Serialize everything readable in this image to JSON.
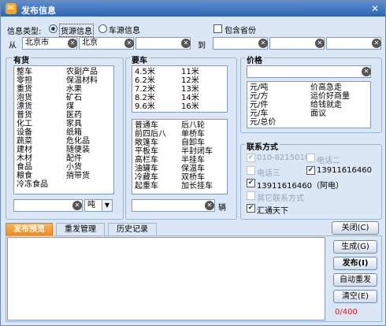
{
  "window": {
    "title": "发布信息"
  },
  "info_type": {
    "label": "信息类型:",
    "opt_goods": "货源信息",
    "opt_vehicle": "车源信息",
    "include_province": "包含省份"
  },
  "route": {
    "from_label": "从",
    "to_label": "到",
    "from1": "北京市",
    "from2": "北京",
    "from3": "",
    "to1": "",
    "to2": "",
    "to3": ""
  },
  "goods": {
    "title": "有货",
    "col1": [
      "整车",
      "零担",
      "重货",
      "泡货",
      "漂货",
      "普货",
      "化工",
      "设备",
      "蔬菜",
      "建材",
      "木材",
      "食品",
      "粮食",
      "冷冻食品"
    ],
    "col2": [
      "农副产品",
      "保温材料",
      "水果",
      "矿石",
      "煤",
      "医药",
      "家具",
      "纸箱",
      "危化品",
      "随便装",
      "配件",
      "小货",
      "捎带货"
    ],
    "unit": "吨"
  },
  "vehicle": {
    "title": "要车",
    "len_col1": [
      "4.5米",
      "6.2米",
      "7.2米",
      "8.2米",
      "9.6米"
    ],
    "len_col2": [
      "11米",
      "12米",
      "13米",
      "14米",
      "16米"
    ],
    "type_col1": [
      "普通车",
      "前四后八",
      "敞篷车",
      "平板车",
      "高栏车",
      "油罐车",
      "冷藏车",
      "起重车"
    ],
    "type_col2": [
      "后八轮",
      "单桥车",
      "自卸车",
      "半封闭车",
      "半挂车",
      "保温车",
      "双桥车",
      "加长挂车"
    ],
    "unit": "辆"
  },
  "price": {
    "title": "价格",
    "col1": [
      "元/吨",
      "元/方",
      "元/件",
      "元/车",
      "元/总价"
    ],
    "col2": [
      "价高急走",
      "运价好商量",
      "给钱就走",
      "面议"
    ]
  },
  "contact": {
    "title": "联系方式",
    "phone1": "010-82150102",
    "phone2": "电话二",
    "phone3": "电话三",
    "mobile1": "13911616460",
    "mobile2": "13911616460（阿电）",
    "other": "其它联系方式",
    "network": "汇通天下"
  },
  "buttons": {
    "close": "关闭(C)",
    "generate": "生成(G)",
    "publish": "发布(I)",
    "auto_repub": "自动重发",
    "clear": "清空(E)"
  },
  "tabs": [
    "发布预览",
    "重发管理",
    "历史记录"
  ],
  "counter": "0/400"
}
